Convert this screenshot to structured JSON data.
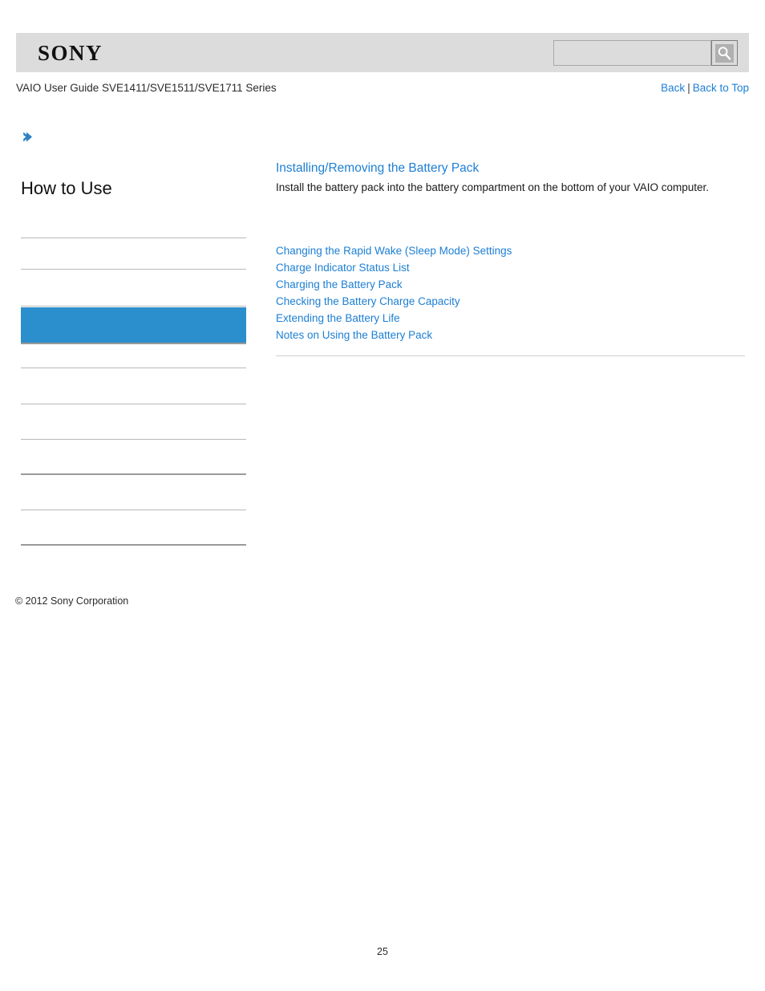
{
  "header": {
    "logo_text": "SONY",
    "search": {
      "value": "",
      "placeholder": "",
      "button_icon": "search-icon"
    }
  },
  "title_bar": {
    "guide_title": "VAIO User Guide SVE1411/SVE1511/SVE1711 Series",
    "back_label": "Back",
    "separator": "|",
    "back_to_top_label": "Back to Top"
  },
  "sidebar": {
    "chevron_icon": "chevron-right-icon",
    "heading": "How to Use",
    "items": [
      {
        "label": "",
        "selected": false,
        "rule": "thin"
      },
      {
        "label": "",
        "selected": false,
        "rule": "thin"
      },
      {
        "label": "",
        "selected": false,
        "rule": "thin"
      },
      {
        "label": "",
        "selected": true,
        "rule": "thick"
      },
      {
        "label": "",
        "selected": false,
        "rule": "thin"
      },
      {
        "label": "",
        "selected": false,
        "rule": "thin"
      },
      {
        "label": "",
        "selected": false,
        "rule": "thin"
      },
      {
        "label": "",
        "selected": false,
        "rule": "thick"
      },
      {
        "label": "",
        "selected": false,
        "rule": "thin"
      },
      {
        "label": "",
        "selected": false,
        "rule": "thick"
      }
    ],
    "copyright": "© 2012 Sony Corporation"
  },
  "main": {
    "heading": "Installing/Removing the Battery Pack",
    "description": "Install the battery pack into the battery compartment on the bottom of your VAIO computer.",
    "related_links": [
      "Changing the Rapid Wake (Sleep Mode) Settings",
      "Charge Indicator Status List",
      "Charging the Battery Pack",
      "Checking the Battery Charge Capacity",
      "Extending the Battery Life",
      "Notes on Using the Battery Pack"
    ]
  },
  "footer": {
    "page_number": "25"
  },
  "colors": {
    "link_blue": "#1d7fd4",
    "selected_blue": "#2b8fcd",
    "header_grey": "#dcdcdc"
  }
}
